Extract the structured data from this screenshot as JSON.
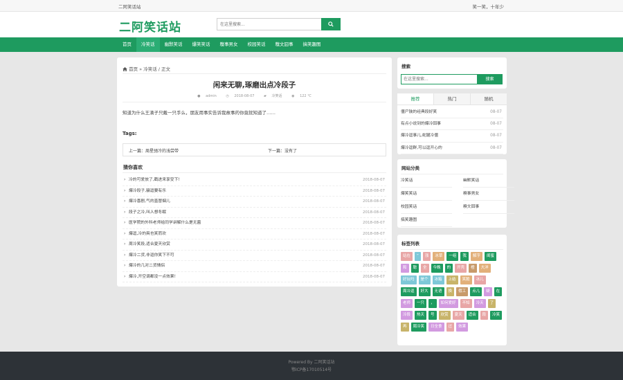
{
  "topbar": {
    "site_name": "二阿笑话站",
    "motto": "笑一笑，十年少"
  },
  "header": {
    "logo": "二阿笑话站",
    "search_placeholder": "在这里搜索..."
  },
  "nav": {
    "items": [
      "首页",
      "冷笑话",
      "幽默笑话",
      "爆笑笑话",
      "糗事男女",
      "校园笑话",
      "糗文囧事",
      "搞笑趣图"
    ],
    "active": 1
  },
  "article": {
    "breadcrumb": {
      "home": "首页",
      "sep": "»",
      "category": "冷笑话",
      "tail": "/ 正文"
    },
    "title": "闲来无聊,琢磨出点冷段子",
    "meta": {
      "author": "admin",
      "date": "2018-08-07",
      "category": "冷笑话",
      "views": "122 ℃"
    },
    "content": "知道为什么王滴子只戴一只手么，朋友用事实告诉我故事的你竟就知道了……",
    "tags_label": "Tags:",
    "prev": "上一篇：周星驰冷的浅尝带",
    "next": "下一篇：没有了",
    "guess_title": "猜你喜欢",
    "guess_list": [
      {
        "title": "冷的可爱放了,戳进来享受下!",
        "date": "2018-08-07"
      },
      {
        "title": "爆冷段子,骗逗要有乐",
        "date": "2018-08-07"
      },
      {
        "title": "爆冷喜剧,气的直冒烟儿",
        "date": "2018-08-07"
      },
      {
        "title": "段子之冷,叫人想冬眠",
        "date": "2018-08-07"
      },
      {
        "title": "医学院的外科老师给同学讲解什么是无菌",
        "date": "2018-08-07"
      },
      {
        "title": "爆逗,冷的爽也笑而欢",
        "date": "2018-08-07"
      },
      {
        "title": "周冷笑段,适合夏天欣赏",
        "date": "2018-08-07"
      },
      {
        "title": "爆冷二货,非逗你笑下不可",
        "date": "2018-08-07"
      },
      {
        "title": "爆冷的几对二货情侣",
        "date": "2018-08-07"
      },
      {
        "title": "爆冷,开空调都没一点效果!",
        "date": "2018-08-07"
      }
    ]
  },
  "sidebar": {
    "search": {
      "title": "搜索",
      "placeholder": "在这里搜索...",
      "button": "搜索"
    },
    "tabs": [
      "推荐",
      "热门",
      "随机"
    ],
    "hot_list": [
      {
        "title": "僵尸陕的经典段好笑",
        "date": "08-07"
      },
      {
        "title": "有点小说到的爆冷囧事",
        "date": "08-07"
      },
      {
        "title": "爆冷逗事儿,蛇腿冷僵",
        "date": "08-07"
      },
      {
        "title": "爆冷逗群,可以逗开心的",
        "date": "08-07"
      }
    ],
    "categories_title": "网站分类",
    "categories": [
      "冷笑话",
      "幽默笑话",
      "爆笑笑话",
      "糗事男女",
      "校园笑话",
      "糗文囧事",
      "搞笑趣图"
    ],
    "tags_title": "标签列表",
    "tags": [
      {
        "t": "站在",
        "c": "#e8a6a6"
      },
      {
        "t": "”",
        "c": "#7ec8d8"
      },
      {
        "t": "涨",
        "c": "#e8a6a6"
      },
      {
        "t": "冰草",
        "c": "#e2b07a"
      },
      {
        "t": "一组",
        "c": "#1e9b5f"
      },
      {
        "t": "我",
        "c": "#1e9b5f"
      },
      {
        "t": "解字",
        "c": "#e2b07a"
      },
      {
        "t": "闺蜜",
        "c": "#1e9b5f"
      },
      {
        "t": "和",
        "c": "#d29ae0"
      },
      {
        "t": "聪",
        "c": "#1e9b5f"
      },
      {
        "t": "全",
        "c": "#e8a6a6"
      },
      {
        "t": "今晚",
        "c": "#1e9b5f"
      },
      {
        "t": "的",
        "c": "#1e9b5f"
      },
      {
        "t": "开壳",
        "c": "#e8a6a6"
      },
      {
        "t": "橙",
        "c": "#c89a6a"
      },
      {
        "t": "大洋",
        "c": "#e2b07a"
      },
      {
        "t": "好玩吗",
        "c": "#7ec8d8"
      },
      {
        "t": "是个",
        "c": "#7ec8d8"
      },
      {
        "t": "冰箱",
        "c": "#7ec8d8"
      },
      {
        "t": "上结",
        "c": "#c8b46a"
      },
      {
        "t": "笑脆",
        "c": "#e2b07a"
      },
      {
        "t": "冰儿",
        "c": "#e8a6a6"
      },
      {
        "t": "周冷逗",
        "c": "#1e9b5f"
      },
      {
        "t": "好大",
        "c": "#1e9b5f"
      },
      {
        "t": "无语",
        "c": "#1e9b5f"
      },
      {
        "t": "换",
        "c": "#c8b46a"
      },
      {
        "t": "假工",
        "c": "#c89a6a"
      },
      {
        "t": "点儿",
        "c": "#1e9b5f"
      },
      {
        "t": "疑",
        "c": "#d29ae0"
      },
      {
        "t": "在",
        "c": "#1e9b5f"
      },
      {
        "t": "老师",
        "c": "#d29ae0"
      },
      {
        "t": "一只",
        "c": "#1e9b5f"
      },
      {
        "t": "，",
        "c": "#1e9b5f"
      },
      {
        "t": "如何爱好",
        "c": "#d29ae0"
      },
      {
        "t": "不知",
        "c": "#e8a6a6"
      },
      {
        "t": "冷天",
        "c": "#d29ae0"
      },
      {
        "t": "了",
        "c": "#c8b46a"
      },
      {
        "t": "冷段",
        "c": "#d29ae0"
      },
      {
        "t": "热天",
        "c": "#1e9b5f"
      },
      {
        "t": "号",
        "c": "#1e9b5f"
      },
      {
        "t": "欣赏",
        "c": "#c8b46a"
      },
      {
        "t": "夏天",
        "c": "#e8a6a6"
      },
      {
        "t": "适合",
        "c": "#1e9b5f"
      },
      {
        "t": "段",
        "c": "#e8a6a6"
      },
      {
        "t": "冷笑",
        "c": "#1e9b5f"
      },
      {
        "t": "再",
        "c": "#c8b46a"
      },
      {
        "t": "周冷笑",
        "c": "#1e9b5f"
      },
      {
        "t": "日全食",
        "c": "#d29ae0"
      },
      {
        "t": "过",
        "c": "#e8a6a6"
      },
      {
        "t": "效果",
        "c": "#d29ae0"
      }
    ]
  },
  "footer": {
    "line1": "Powered By 二阿笑话站",
    "line2": "鄂ICP备17010514号"
  },
  "colors": {
    "brand": "#1e9b5f",
    "nav_active": "#2bad74",
    "footer_bg": "#2d3237"
  }
}
